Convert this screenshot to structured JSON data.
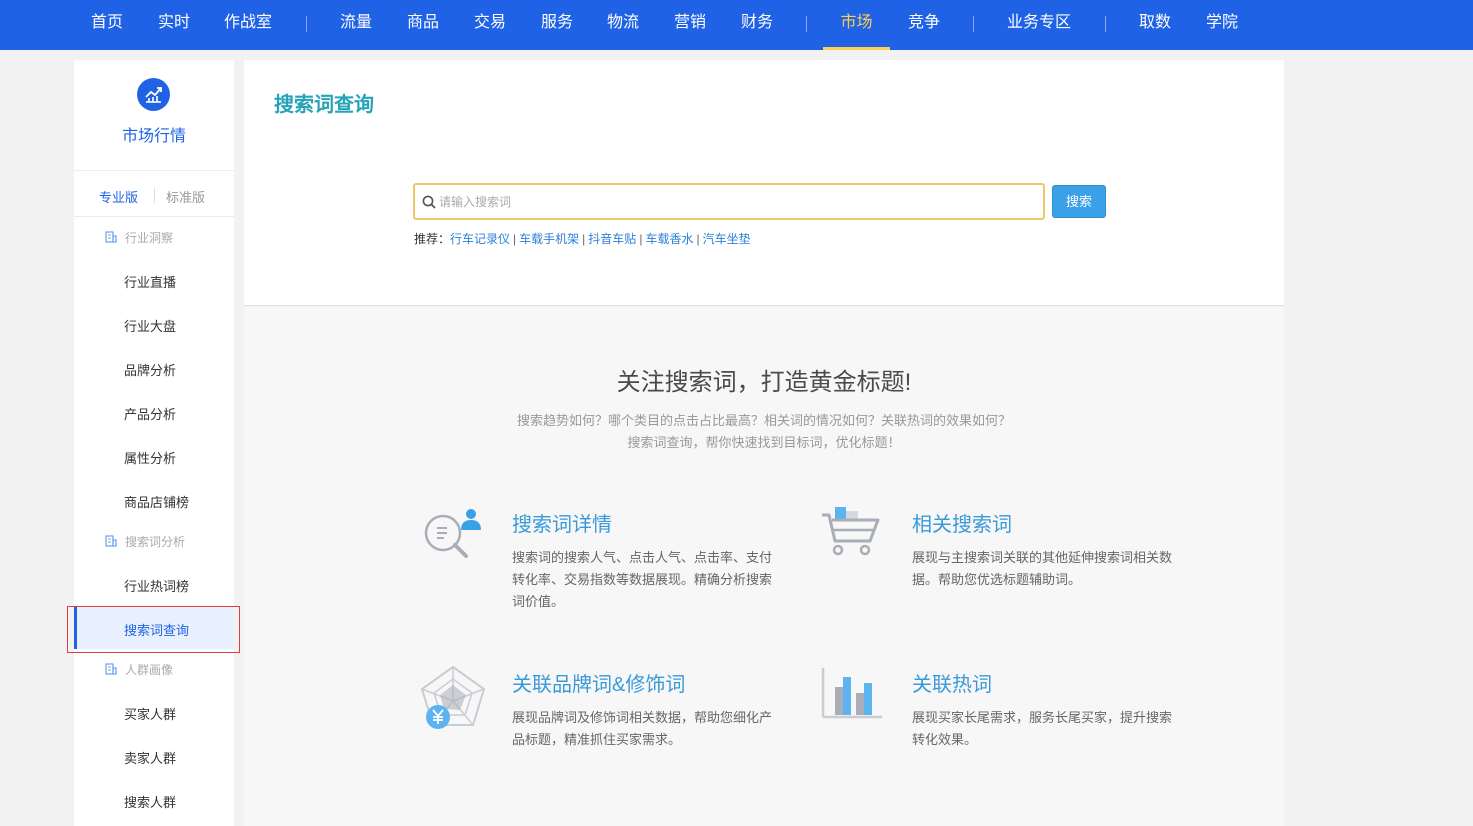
{
  "topnav": {
    "items": [
      "首页",
      "实时",
      "作战室",
      "流量",
      "商品",
      "交易",
      "服务",
      "物流",
      "营销",
      "财务",
      "市场",
      "竞争",
      "业务专区",
      "取数",
      "学院"
    ],
    "active": "市场"
  },
  "sidebar": {
    "logo_icon": "market-chart-icon",
    "title": "市场行情",
    "tabs": [
      "专业版",
      "标准版"
    ],
    "groups": [
      {
        "label": "行业洞察",
        "items": [
          "行业直播",
          "行业大盘",
          "品牌分析",
          "产品分析",
          "属性分析",
          "商品店铺榜"
        ]
      },
      {
        "label": "搜索词分析",
        "items": [
          "行业热词榜",
          "搜索词查询"
        ]
      },
      {
        "label": "人群画像",
        "items": [
          "买家人群",
          "卖家人群",
          "搜索人群"
        ]
      }
    ],
    "active_item": "搜索词查询"
  },
  "main": {
    "page_title": "搜索词查询",
    "search": {
      "placeholder": "请输入搜索词",
      "value": "",
      "button": "搜索"
    },
    "recommend": {
      "label": "推荐：",
      "links": [
        "行车记录仪",
        "车载手机架",
        "抖音车贴",
        "车载香水",
        "汽车坐垫"
      ],
      "separator": "|"
    },
    "headline": "关注搜索词，打造黄金标题!",
    "subline1": "搜索趋势如何？哪个类目的点击占比最高？相关词的情况如何？关联热词的效果如何？",
    "subline2": "搜索词查询，帮你快速找到目标词，优化标题！",
    "features": [
      {
        "icon": "search-analysis-icon",
        "title": "搜索词详情",
        "desc": "搜索词的搜索人气、点击人气、点击率、支付转化率、交易指数等数据展现。精确分析搜索词价值。"
      },
      {
        "icon": "shopping-cart-icon",
        "title": "相关搜索词",
        "desc": "展现与主搜索词关联的其他延伸搜索词相关数据。帮助您优选标题辅助词。"
      },
      {
        "icon": "radar-yen-icon",
        "title": "关联品牌词&修饰词",
        "desc": "展现品牌词及修饰词相关数据，帮助您细化产品标题，精准抓住买家需求。"
      },
      {
        "icon": "bar-chart-icon",
        "title": "关联热词",
        "desc": "展现买家长尾需求，服务长尾买家，提升搜索转化效果。"
      }
    ]
  },
  "colors": {
    "nav_bg": "#2062e6",
    "nav_active": "#ffcf52",
    "title_teal": "#27a3b8",
    "link_blue": "#2d7fd8",
    "button_blue": "#3aa0e8",
    "highlight_red": "#e63c3c"
  }
}
